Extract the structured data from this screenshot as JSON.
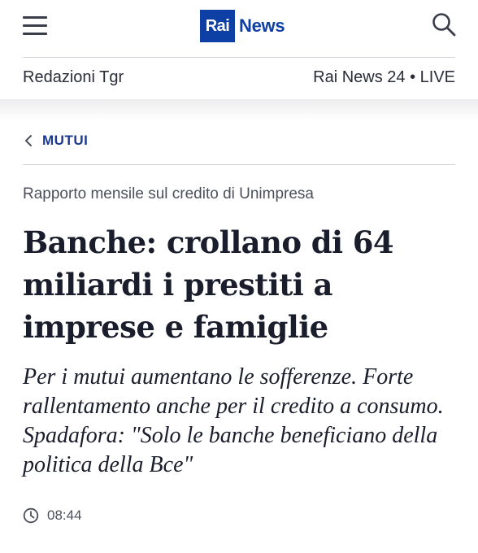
{
  "header": {
    "logo_left": "Rai",
    "logo_right": "News",
    "nav_left": "Redazioni Tgr",
    "nav_right": "Rai News 24 • LIVE"
  },
  "breadcrumb": {
    "label": "MUTUI"
  },
  "article": {
    "kicker": "Rapporto mensile sul credito di Unimpresa",
    "title": "Banche: crollano di 64 miliardi i prestiti a imprese e famiglie",
    "subtitle": "Per i mutui aumentano le sofferenze. Forte rallentamento anche per il credito a consumo. Spadafora: \"Solo le banche beneficiano della politica della Bce\"",
    "time": "08:44"
  },
  "colors": {
    "brand_blue": "#0e3fa4",
    "text_dark": "#1a1d2b",
    "text_muted": "#4d505b"
  },
  "icons": {
    "menu": "hamburger-icon",
    "search": "search-icon",
    "back": "chevron-left-icon",
    "clock": "clock-icon"
  }
}
